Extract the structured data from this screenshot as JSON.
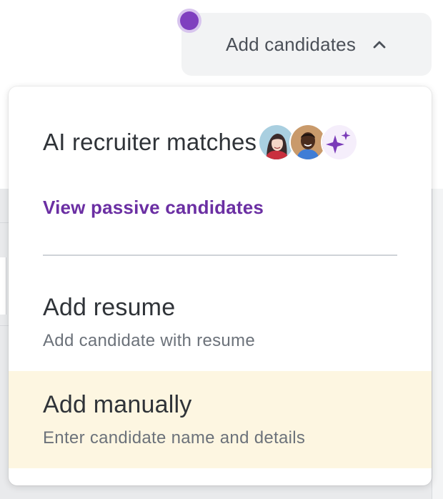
{
  "toggle": {
    "label": "Add candidates",
    "expanded_icon": "chevron-up-icon",
    "indicator_color": "#7f3fbf"
  },
  "menu": {
    "ai_section": {
      "title": "AI recruiter matches",
      "avatars": [
        "woman-avatar",
        "man-avatar",
        "sparkle-icon"
      ],
      "link": "View passive candidates",
      "link_color": "#6b2fa3"
    },
    "items": [
      {
        "title": "Add resume",
        "subtitle": "Add candidate with resume",
        "highlighted": false
      },
      {
        "title": "Add manually",
        "subtitle": "Enter candidate name and details",
        "highlighted": true,
        "highlight_color": "#fdf6e1"
      }
    ]
  }
}
